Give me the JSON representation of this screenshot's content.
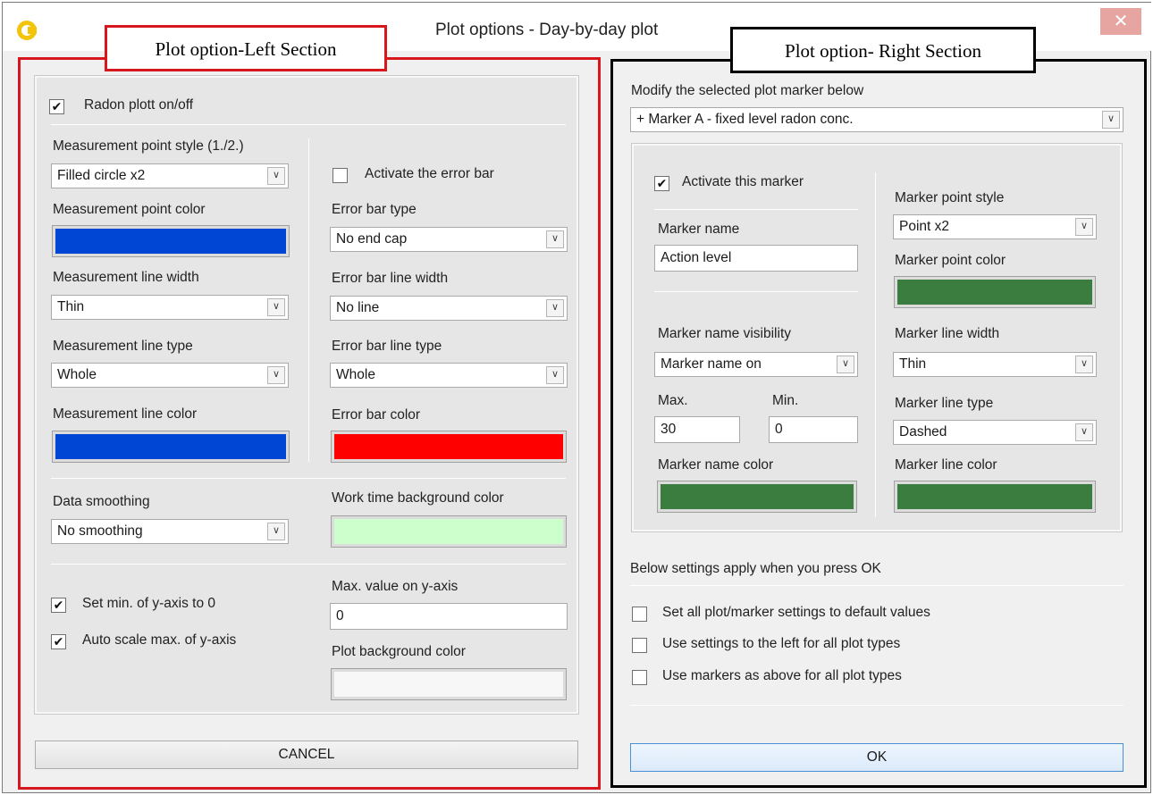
{
  "window": {
    "title": "Plot options - Day-by-day plot",
    "close_glyph": "✕",
    "icon": "app-icon"
  },
  "callouts": {
    "left": "Plot option-Left Section",
    "right": "Plot option- Right Section"
  },
  "left": {
    "radon_toggle": {
      "checked": true,
      "label": "Radon plott on/off"
    },
    "point_style": {
      "label": "Measurement point style (1./2.)",
      "value": "Filled circle x2"
    },
    "point_color": {
      "label": "Measurement point color",
      "color": "#0046d5"
    },
    "line_width": {
      "label": "Measurement line width",
      "value": "Thin"
    },
    "line_type": {
      "label": "Measurement line type",
      "value": "Whole"
    },
    "line_color": {
      "label": "Measurement line color",
      "color": "#0046d5"
    },
    "error_bar_toggle": {
      "checked": false,
      "label": "Activate the error bar"
    },
    "error_bar_type": {
      "label": "Error bar type",
      "value": "No end cap"
    },
    "error_bar_line_width": {
      "label": "Error bar line width",
      "value": "No line"
    },
    "error_bar_line_type": {
      "label": "Error bar line type",
      "value": "Whole"
    },
    "error_bar_color": {
      "label": "Error bar color",
      "color": "#ff0000"
    },
    "data_smoothing": {
      "label": "Data smoothing",
      "value": "No smoothing"
    },
    "work_time_bg": {
      "label": "Work time background color",
      "color": "#ccffcc"
    },
    "set_min_zero": {
      "checked": true,
      "label": "Set min. of y-axis to 0"
    },
    "auto_scale": {
      "checked": true,
      "label": "Auto scale max. of y-axis"
    },
    "max_y": {
      "label": "Max. value on y-axis",
      "value": "0"
    },
    "plot_bg": {
      "label": "Plot background color",
      "color": "#f7f7f7"
    },
    "cancel_label": "CANCEL"
  },
  "right": {
    "modify_label": "Modify the selected plot marker below",
    "marker_select": "+ Marker A - fixed level radon conc.",
    "activate_marker": {
      "checked": true,
      "label": "Activate this marker"
    },
    "marker_name": {
      "label": "Marker name",
      "value": "Action level"
    },
    "name_visibility": {
      "label": "Marker name visibility",
      "value": "Marker name on"
    },
    "max": {
      "label": "Max.",
      "value": "30"
    },
    "min": {
      "label": "Min.",
      "value": "0"
    },
    "name_color": {
      "label": "Marker name color",
      "color": "#3a7d3e"
    },
    "point_style": {
      "label": "Marker point style",
      "value": "Point x2"
    },
    "point_color": {
      "label": "Marker point color",
      "color": "#3a7d3e"
    },
    "line_width": {
      "label": "Marker line width",
      "value": "Thin"
    },
    "line_type": {
      "label": "Marker line type",
      "value": "Dashed"
    },
    "line_color": {
      "label": "Marker line color",
      "color": "#3a7d3e"
    },
    "apply_note": "Below settings apply when you press OK",
    "options": [
      {
        "checked": false,
        "label": "Set all plot/marker settings to default values"
      },
      {
        "checked": false,
        "label": "Use settings to the left for all plot types"
      },
      {
        "checked": false,
        "label": "Use markers as above for all plot types"
      }
    ],
    "ok_label": "OK"
  }
}
